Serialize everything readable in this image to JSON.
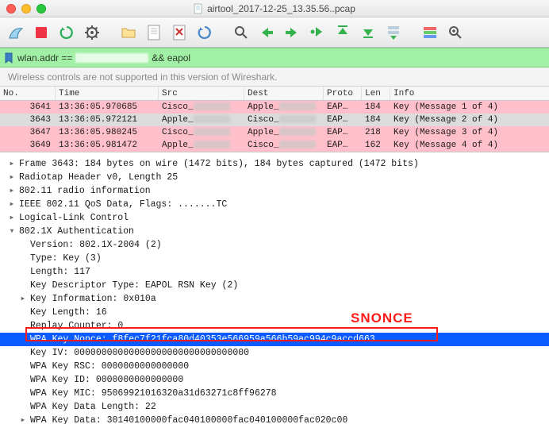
{
  "window": {
    "title": "airtool_2017-12-25_13.35.56..pcap"
  },
  "filter": {
    "prefix": "wlan.addr == ",
    "suffix": "&& eapol"
  },
  "infobar": {
    "text": "Wireless controls are not supported in this version of Wireshark."
  },
  "columns": {
    "no": "No.",
    "time": "Time",
    "src": "Src",
    "dest": "Dest",
    "proto": "Proto",
    "len": "Len",
    "info": "Info"
  },
  "packets": [
    {
      "no": "3641",
      "time": "13:36:05.970685",
      "src": "Cisco_",
      "dest": "Apple_",
      "proto": "EAP…",
      "len": "184",
      "info": "Key (Message 1 of 4)",
      "cls": "row-pink"
    },
    {
      "no": "3643",
      "time": "13:36:05.972121",
      "src": "Apple_",
      "dest": "Cisco_",
      "proto": "EAP…",
      "len": "184",
      "info": "Key (Message 2 of 4)",
      "cls": "row-sel"
    },
    {
      "no": "3647",
      "time": "13:36:05.980245",
      "src": "Cisco_",
      "dest": "Apple_",
      "proto": "EAP…",
      "len": "218",
      "info": "Key (Message 3 of 4)",
      "cls": "row-pink"
    },
    {
      "no": "3649",
      "time": "13:36:05.981472",
      "src": "Apple_",
      "dest": "Cisco_",
      "proto": "EAP…",
      "len": "162",
      "info": "Key (Message 4 of 4)",
      "cls": "row-pink"
    }
  ],
  "tree": {
    "frame": "Frame 3643: 184 bytes on wire (1472 bits), 184 bytes captured (1472 bits)",
    "radiotap": "Radiotap Header v0, Length 25",
    "radio": "802.11 radio information",
    "qos": "IEEE 802.11 QoS Data, Flags: .......TC",
    "llc": "Logical-Link Control",
    "auth": "802.1X Authentication",
    "version": "Version: 802.1X-2004 (2)",
    "type": "Type: Key (3)",
    "length": "Length: 117",
    "kdt": "Key Descriptor Type: EAPOL RSN Key (2)",
    "keyinfo": "Key Information: 0x010a",
    "keylen": "Key Length: 16",
    "replay": "Replay Counter: 0",
    "nonce": "WPA Key Nonce: f8fec7f21fca80d40353e566959a566b59ac994c9accd663...",
    "iv": "Key IV: 00000000000000000000000000000000",
    "rsc": "WPA Key RSC: 0000000000000000",
    "id": "WPA Key ID: 0000000000000000",
    "mic": "WPA Key MIC: 95069921016320a31d63271c8ff96278",
    "kdlen": "WPA Key Data Length: 22",
    "kdata": "WPA Key Data: 30140100000fac040100000fac040100000fac020c00"
  },
  "annotation": {
    "snonce": "SNONCE"
  },
  "icons": {
    "fin": "shark-fin-icon",
    "stop": "stop-icon",
    "restart": "restart-icon",
    "options": "gear-icon",
    "open": "folder-icon",
    "save": "save-icon",
    "close": "close-file-icon",
    "reload": "reload-icon",
    "find": "search-icon",
    "back": "arrow-left-icon",
    "fwd": "arrow-right-icon",
    "jump": "goto-icon",
    "first": "first-packet-icon",
    "last": "last-packet-icon",
    "autoscroll": "autoscroll-icon",
    "colorize": "colorize-icon",
    "zoomin": "zoom-in-icon"
  }
}
